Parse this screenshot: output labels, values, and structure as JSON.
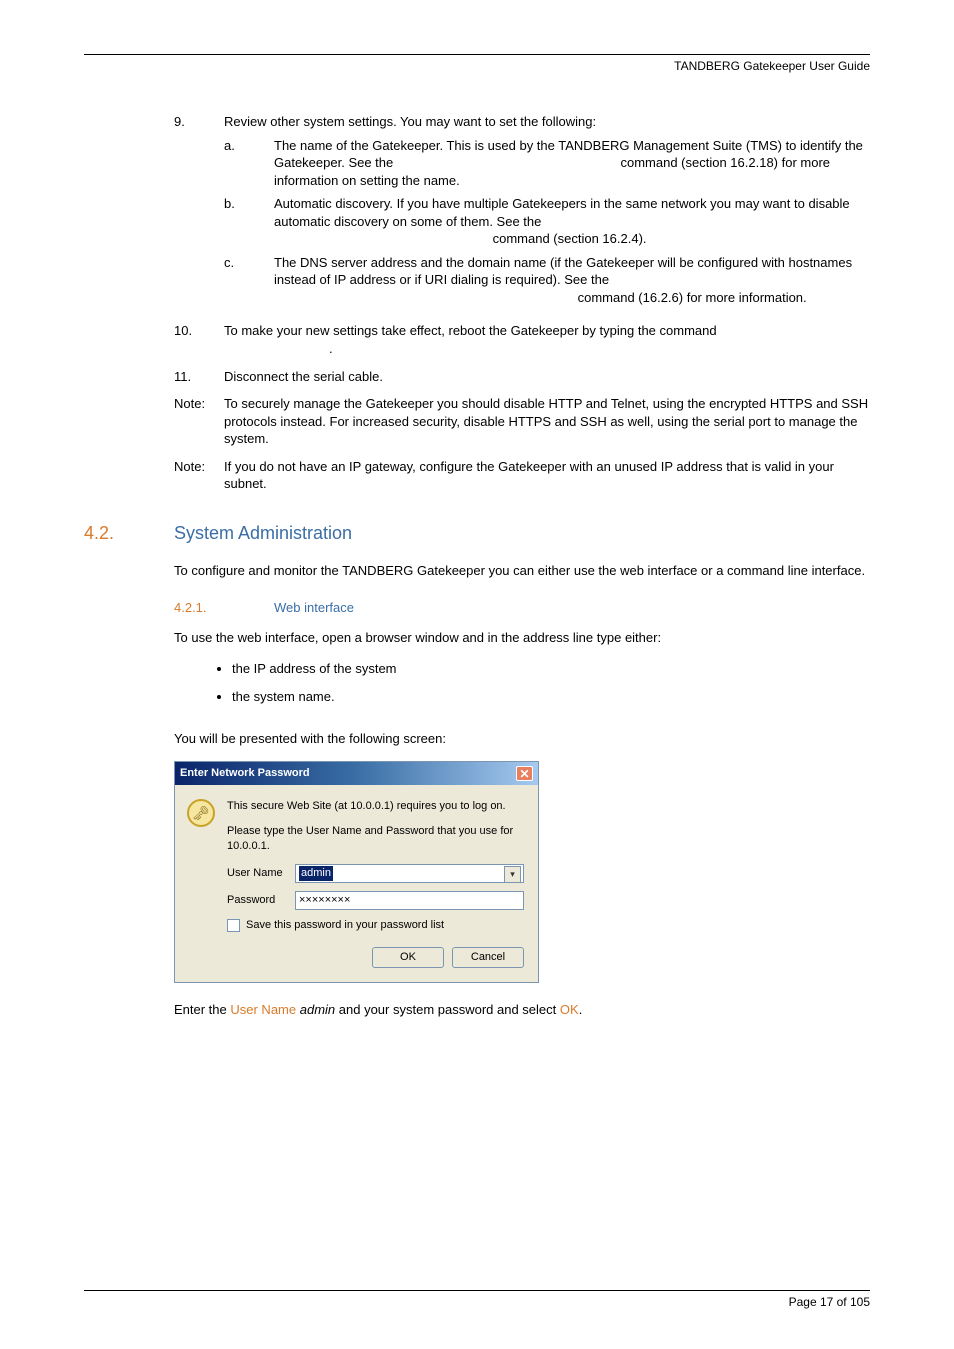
{
  "header": "TANDBERG Gatekeeper User Guide",
  "step9": {
    "num": "9.",
    "intro": "Review other system settings. You may want to set the following:",
    "a": {
      "letter": "a.",
      "text": "The name of the Gatekeeper. This is used by the TANDBERG Management Suite (TMS) to identify the Gatekeeper. See the ",
      "cmd_suffix": " command (section 16.2.18) for more information on setting the name."
    },
    "b": {
      "letter": "b.",
      "text": "Automatic discovery. If you have multiple Gatekeepers in the same network you may want to disable automatic discovery on some of them. See the ",
      "suffix": " command (section 16.2.4)."
    },
    "c": {
      "letter": "c.",
      "text": "The DNS server address and the domain name (if the Gatekeeper will be configured with hostnames instead of IP address or if URI dialing is required). See the ",
      "suffix": " command (16.2.6) for more information."
    }
  },
  "step10": {
    "num": "10.",
    "text": "To make your new settings take effect, reboot the Gatekeeper by typing the command",
    "period": "."
  },
  "step11": {
    "num": "11.",
    "text": "Disconnect the serial cable."
  },
  "note1": {
    "label": "Note:",
    "text": "To securely manage the Gatekeeper you should disable HTTP and Telnet, using the encrypted HTTPS and SSH protocols instead. For increased security, disable HTTPS and SSH as well, using the serial port to manage the system."
  },
  "note2": {
    "label": "Note:",
    "text": "If you do not have an IP gateway, configure the Gatekeeper with an unused IP address that is valid in your subnet."
  },
  "section": {
    "num": "4.2.",
    "title": "System Administration"
  },
  "section_intro": "To configure and monitor the TANDBERG Gatekeeper you can either use the web interface or a command line interface.",
  "subsection": {
    "num": "4.2.1.",
    "title": "Web interface"
  },
  "web_intro": "To use the web interface, open a browser window and in the address line type either:",
  "bullets": {
    "b1": "the IP address of the system",
    "b2": "the system name."
  },
  "screen_intro": "You will be presented with the following screen:",
  "dialog": {
    "title": "Enter Network Password",
    "line1": "This secure Web Site (at 10.0.0.1) requires you to log on.",
    "line2": "Please type the User Name and Password that you use for 10.0.0.1.",
    "user_label": "User Name",
    "user_value": "admin",
    "pass_label": "Password",
    "pass_value": "××××××××",
    "save_label": "Save this password in your password list",
    "ok": "OK",
    "cancel": "Cancel"
  },
  "final": {
    "pre": "Enter the ",
    "user_name": "User Name",
    "admin": " admin",
    "mid": " and your system password and select ",
    "ok": "OK",
    "end": "."
  },
  "footer": "Page 17 of 105"
}
